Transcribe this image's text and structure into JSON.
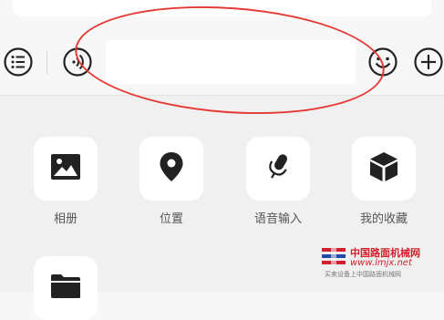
{
  "toolbar": {
    "input": {
      "value": "",
      "placeholder": ""
    },
    "icons": [
      "list-icon",
      "voice-toggle-icon",
      "emoji-icon",
      "plus-icon"
    ]
  },
  "panel": {
    "items": [
      {
        "label": "相册",
        "icon": "image-icon"
      },
      {
        "label": "位置",
        "icon": "location-pin-icon"
      },
      {
        "label": "语音输入",
        "icon": "microphone-icon"
      },
      {
        "label": "我的收藏",
        "icon": "cube-icon"
      },
      {
        "label": "",
        "icon": "folder-icon"
      }
    ]
  },
  "watermark": {
    "title": "中国路面机械网",
    "url": "www.lmjx.net",
    "subtitle": "买卖设备上中国路面机械网"
  },
  "colors": {
    "annotation": "#e53935",
    "watermark": "#d21f2b",
    "icon": "#222222"
  }
}
